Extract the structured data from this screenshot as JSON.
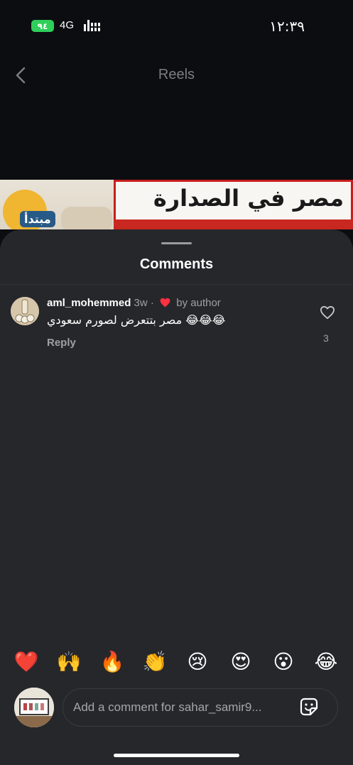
{
  "status_bar": {
    "battery": "٩٤",
    "network": "4G",
    "time": "١٢:٣٩"
  },
  "nav": {
    "title": "Reels",
    "back_icon": "chevron-left-icon"
  },
  "preview": {
    "start_label": "مبتدأ",
    "headline": "مصر في الصدارة"
  },
  "comments_sheet": {
    "title": "Comments",
    "comments": [
      {
        "username": "aml_mohemmed",
        "time": "3w",
        "separator": "·",
        "liked_by_author_label": "by author",
        "text": "مصر بتتعرض لصورم سعودي 😂😂😂",
        "reply_label": "Reply",
        "like_count": "3"
      }
    ]
  },
  "emoji_bar": [
    "❤️",
    "🙌",
    "🔥",
    "👏",
    "😢",
    "😍",
    "😮",
    "😂"
  ],
  "composer": {
    "placeholder": "Add a comment for sahar_samir9..."
  },
  "colors": {
    "sheet_bg": "#26272b",
    "like_red": "#ff3040",
    "muted_text": "#9ea0a5"
  }
}
